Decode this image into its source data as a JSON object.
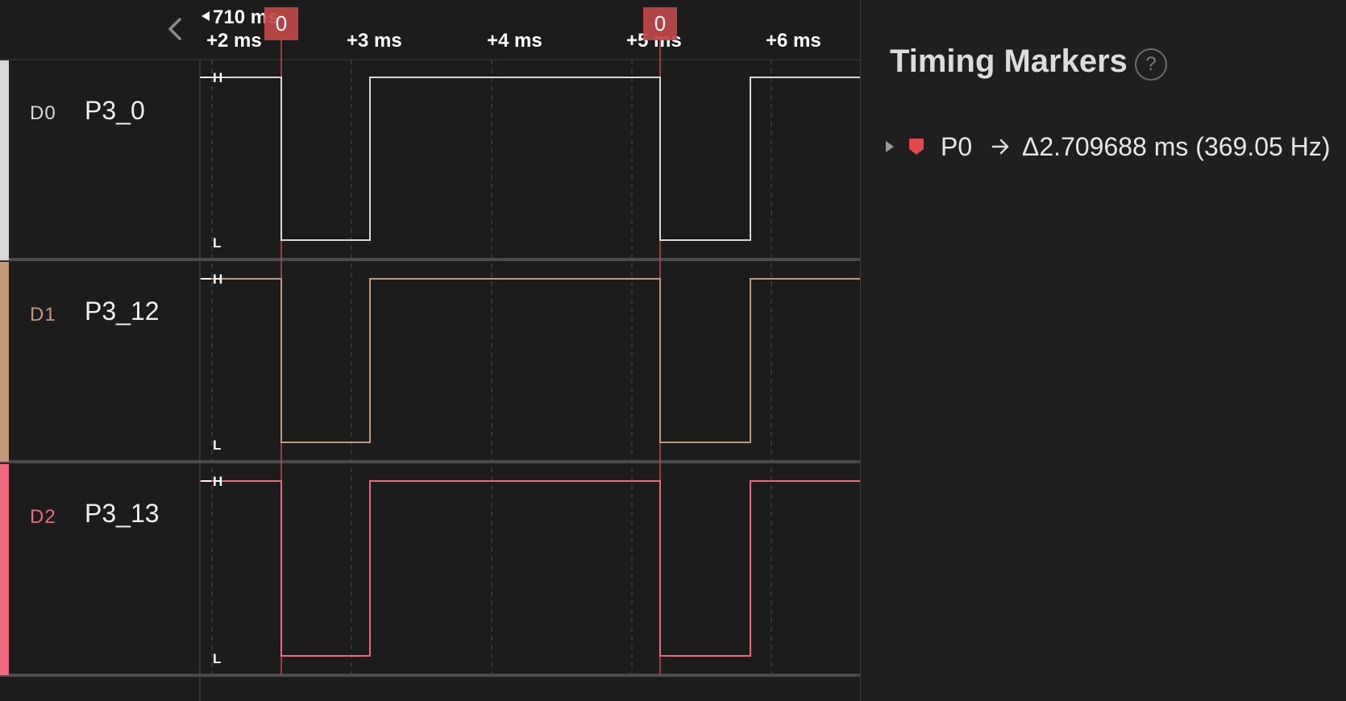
{
  "timeline": {
    "offset_label": "710 ms",
    "ticks": [
      "+2 ms",
      "+3 ms",
      "+4 ms",
      "+5 ms",
      "+6 ms"
    ],
    "level_high": "H",
    "level_low": "L"
  },
  "channels": [
    {
      "id": "D0",
      "name": "P3_0",
      "color": "#d8d8d8"
    },
    {
      "id": "D1",
      "name": "P3_12",
      "color": "#c4967a"
    },
    {
      "id": "D2",
      "name": "P3_13",
      "color": "#f0687c"
    }
  ],
  "marker_flags": [
    "0",
    "0"
  ],
  "marker_color": "#c04848",
  "panel": {
    "title": "Timing Markers",
    "help_glyph": "?",
    "markers": [
      {
        "name": "P0",
        "delta": "Δ2.709688 ms (369.05 Hz)"
      }
    ]
  }
}
